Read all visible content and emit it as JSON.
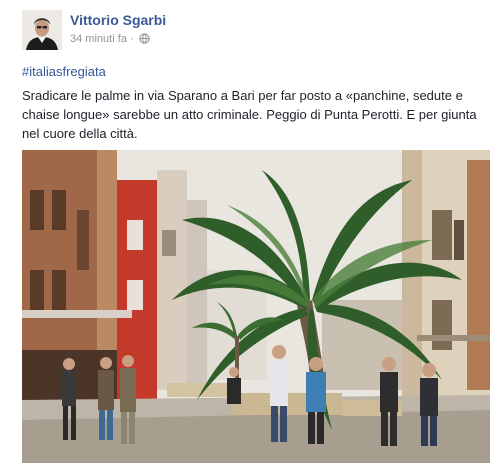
{
  "post": {
    "author": "Vittorio Sgarbi",
    "time": "34 minuti fa",
    "separator": "·",
    "hashtag": "#italiasfregiata",
    "text": "Sradicare le palme in via Sparano a Bari per far posto a «panchine, sedute e chaise longue» sarebbe un atto criminale. Peggio di Punta Perotti. E per giunta nel cuore della città."
  },
  "icons": {
    "avatar": "profile-photo",
    "audience": "globe-icon",
    "photo": "street-with-palm-photo"
  },
  "colors": {
    "link": "#3b5998",
    "meta": "#90949c",
    "text": "#1d2129"
  }
}
